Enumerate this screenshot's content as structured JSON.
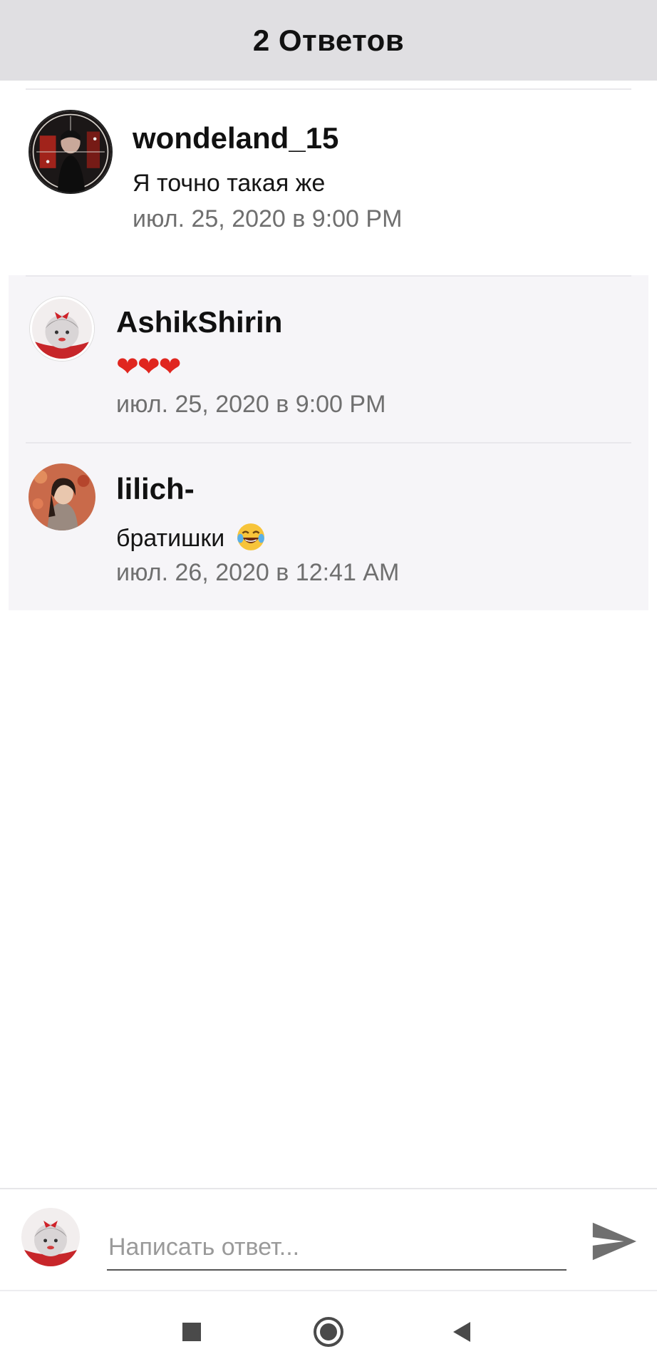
{
  "header": {
    "title": "2 Ответов"
  },
  "comments": [
    {
      "username": "wondeland_15",
      "text": "Я точно такая же",
      "time": "июл. 25, 2020 в 9:00 PM",
      "avatar_icon": "user-avatar-dark-photo"
    },
    {
      "username": "AshikShirin",
      "text": "❤❤❤",
      "time": "июл. 25, 2020 в 9:00 PM",
      "avatar_icon": "user-avatar-anime-red-bow"
    },
    {
      "username": "lilich-",
      "text": "братишки",
      "time": "июл. 26, 2020 в 12:41 AM",
      "avatar_icon": "user-avatar-girl-photo"
    }
  ],
  "composer": {
    "placeholder": "Написать ответ...",
    "send_icon": "send-icon",
    "avatar_icon": "user-avatar-anime-red-bow"
  },
  "navbar": {
    "recent_icon": "recent-apps-icon",
    "home_icon": "home-icon",
    "back_icon": "back-icon"
  },
  "colors": {
    "header_bg": "#e0dfe2",
    "reply_bg": "#f6f5f8",
    "heart": "#e0261f",
    "timestamp": "#6f6f6f"
  }
}
